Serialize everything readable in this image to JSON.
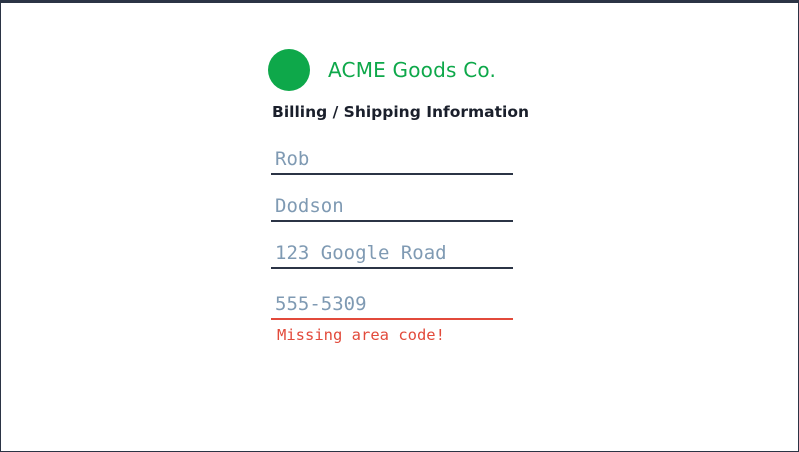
{
  "brand": {
    "name": "ACME Goods Co.",
    "logo_icon": "green-circle-logo",
    "color": "#0ea84a"
  },
  "form": {
    "title": "Billing / Shipping Information",
    "fields": [
      {
        "value": "Rob"
      },
      {
        "value": "Dodson"
      },
      {
        "value": "123 Google Road"
      },
      {
        "value": "555-5309",
        "error": "Missing area code!"
      }
    ]
  },
  "colors": {
    "field_text": "#7f9ab3",
    "underline": "#2b3445",
    "error": "#e24a3b"
  }
}
